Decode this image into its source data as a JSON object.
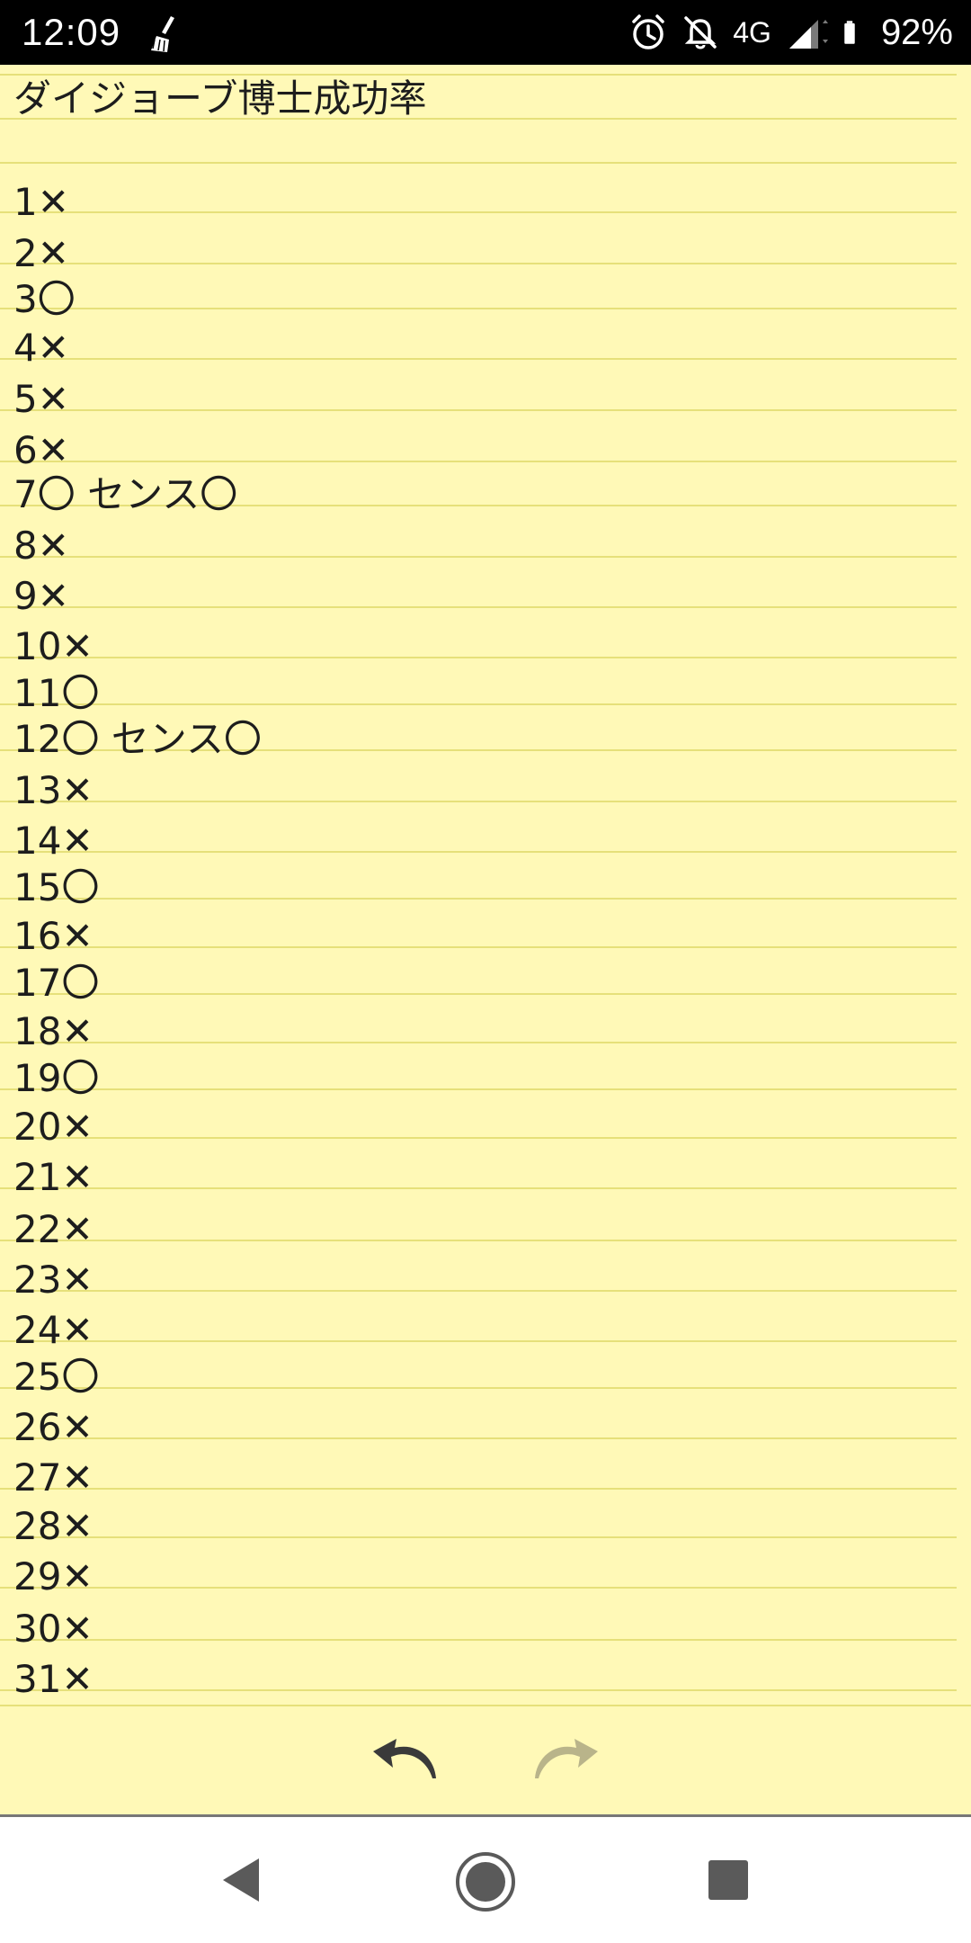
{
  "status_bar": {
    "time": "12:09",
    "network": "4G",
    "battery": "92%"
  },
  "note": {
    "title": "ダイジョーブ博士成功率",
    "lines": [
      "1✕",
      "2✕",
      "3〇",
      "4✕",
      "5✕",
      "6✕",
      "7〇 センス〇",
      "8✕",
      "9✕",
      "10✕",
      "11〇",
      "12〇 センス〇",
      "13✕",
      "14✕",
      "15〇",
      "16✕",
      "17〇",
      "18✕",
      "19〇",
      "20✕",
      "21✕",
      "22✕",
      "23✕",
      "24✕",
      "25〇",
      "26✕",
      "27✕",
      "28✕",
      "29✕",
      "30✕",
      "31✕"
    ]
  },
  "toolbar": {
    "undo_icon": "undo-icon",
    "redo_icon": "redo-icon"
  },
  "nav": {
    "back_icon": "triangle-back-icon",
    "home_icon": "circle-home-icon",
    "recents_icon": "square-recents-icon"
  },
  "colors": {
    "paper": "#fff9b7",
    "rule": "#e6e07a",
    "text": "#1d1d1d",
    "status_bar": "#000000"
  }
}
